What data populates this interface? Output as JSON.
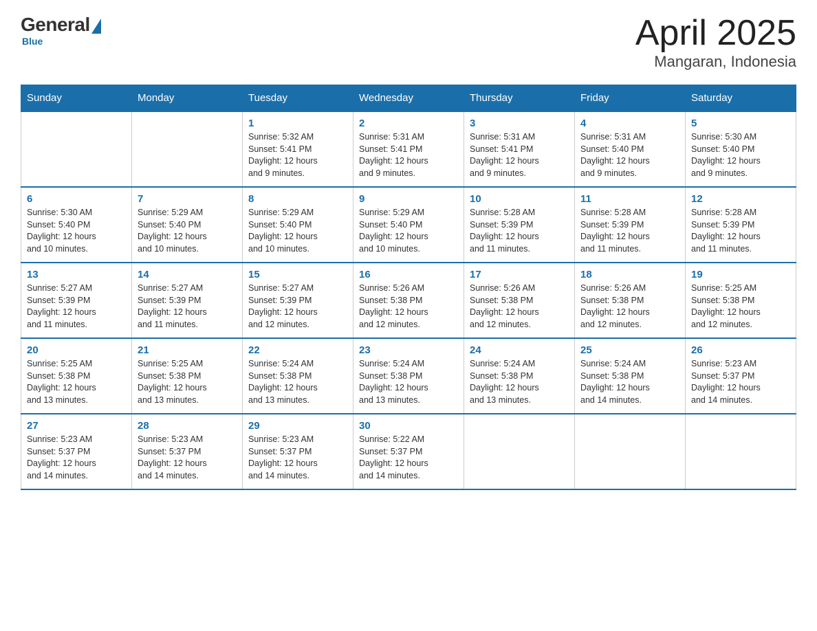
{
  "logo": {
    "general": "General",
    "blue": "Blue",
    "subtitle": "Blue"
  },
  "title": "April 2025",
  "location": "Mangaran, Indonesia",
  "days_of_week": [
    "Sunday",
    "Monday",
    "Tuesday",
    "Wednesday",
    "Thursday",
    "Friday",
    "Saturday"
  ],
  "weeks": [
    [
      {
        "day": "",
        "info": ""
      },
      {
        "day": "",
        "info": ""
      },
      {
        "day": "1",
        "sunrise": "5:32 AM",
        "sunset": "5:41 PM",
        "daylight": "12 hours and 9 minutes."
      },
      {
        "day": "2",
        "sunrise": "5:31 AM",
        "sunset": "5:41 PM",
        "daylight": "12 hours and 9 minutes."
      },
      {
        "day": "3",
        "sunrise": "5:31 AM",
        "sunset": "5:41 PM",
        "daylight": "12 hours and 9 minutes."
      },
      {
        "day": "4",
        "sunrise": "5:31 AM",
        "sunset": "5:40 PM",
        "daylight": "12 hours and 9 minutes."
      },
      {
        "day": "5",
        "sunrise": "5:30 AM",
        "sunset": "5:40 PM",
        "daylight": "12 hours and 9 minutes."
      }
    ],
    [
      {
        "day": "6",
        "sunrise": "5:30 AM",
        "sunset": "5:40 PM",
        "daylight": "12 hours and 10 minutes."
      },
      {
        "day": "7",
        "sunrise": "5:29 AM",
        "sunset": "5:40 PM",
        "daylight": "12 hours and 10 minutes."
      },
      {
        "day": "8",
        "sunrise": "5:29 AM",
        "sunset": "5:40 PM",
        "daylight": "12 hours and 10 minutes."
      },
      {
        "day": "9",
        "sunrise": "5:29 AM",
        "sunset": "5:40 PM",
        "daylight": "12 hours and 10 minutes."
      },
      {
        "day": "10",
        "sunrise": "5:28 AM",
        "sunset": "5:39 PM",
        "daylight": "12 hours and 11 minutes."
      },
      {
        "day": "11",
        "sunrise": "5:28 AM",
        "sunset": "5:39 PM",
        "daylight": "12 hours and 11 minutes."
      },
      {
        "day": "12",
        "sunrise": "5:28 AM",
        "sunset": "5:39 PM",
        "daylight": "12 hours and 11 minutes."
      }
    ],
    [
      {
        "day": "13",
        "sunrise": "5:27 AM",
        "sunset": "5:39 PM",
        "daylight": "12 hours and 11 minutes."
      },
      {
        "day": "14",
        "sunrise": "5:27 AM",
        "sunset": "5:39 PM",
        "daylight": "12 hours and 11 minutes."
      },
      {
        "day": "15",
        "sunrise": "5:27 AM",
        "sunset": "5:39 PM",
        "daylight": "12 hours and 12 minutes."
      },
      {
        "day": "16",
        "sunrise": "5:26 AM",
        "sunset": "5:38 PM",
        "daylight": "12 hours and 12 minutes."
      },
      {
        "day": "17",
        "sunrise": "5:26 AM",
        "sunset": "5:38 PM",
        "daylight": "12 hours and 12 minutes."
      },
      {
        "day": "18",
        "sunrise": "5:26 AM",
        "sunset": "5:38 PM",
        "daylight": "12 hours and 12 minutes."
      },
      {
        "day": "19",
        "sunrise": "5:25 AM",
        "sunset": "5:38 PM",
        "daylight": "12 hours and 12 minutes."
      }
    ],
    [
      {
        "day": "20",
        "sunrise": "5:25 AM",
        "sunset": "5:38 PM",
        "daylight": "12 hours and 13 minutes."
      },
      {
        "day": "21",
        "sunrise": "5:25 AM",
        "sunset": "5:38 PM",
        "daylight": "12 hours and 13 minutes."
      },
      {
        "day": "22",
        "sunrise": "5:24 AM",
        "sunset": "5:38 PM",
        "daylight": "12 hours and 13 minutes."
      },
      {
        "day": "23",
        "sunrise": "5:24 AM",
        "sunset": "5:38 PM",
        "daylight": "12 hours and 13 minutes."
      },
      {
        "day": "24",
        "sunrise": "5:24 AM",
        "sunset": "5:38 PM",
        "daylight": "12 hours and 13 minutes."
      },
      {
        "day": "25",
        "sunrise": "5:24 AM",
        "sunset": "5:38 PM",
        "daylight": "12 hours and 14 minutes."
      },
      {
        "day": "26",
        "sunrise": "5:23 AM",
        "sunset": "5:37 PM",
        "daylight": "12 hours and 14 minutes."
      }
    ],
    [
      {
        "day": "27",
        "sunrise": "5:23 AM",
        "sunset": "5:37 PM",
        "daylight": "12 hours and 14 minutes."
      },
      {
        "day": "28",
        "sunrise": "5:23 AM",
        "sunset": "5:37 PM",
        "daylight": "12 hours and 14 minutes."
      },
      {
        "day": "29",
        "sunrise": "5:23 AM",
        "sunset": "5:37 PM",
        "daylight": "12 hours and 14 minutes."
      },
      {
        "day": "30",
        "sunrise": "5:22 AM",
        "sunset": "5:37 PM",
        "daylight": "12 hours and 14 minutes."
      },
      {
        "day": "",
        "info": ""
      },
      {
        "day": "",
        "info": ""
      },
      {
        "day": "",
        "info": ""
      }
    ]
  ],
  "labels": {
    "sunrise": "Sunrise:",
    "sunset": "Sunset:",
    "daylight": "Daylight:"
  }
}
